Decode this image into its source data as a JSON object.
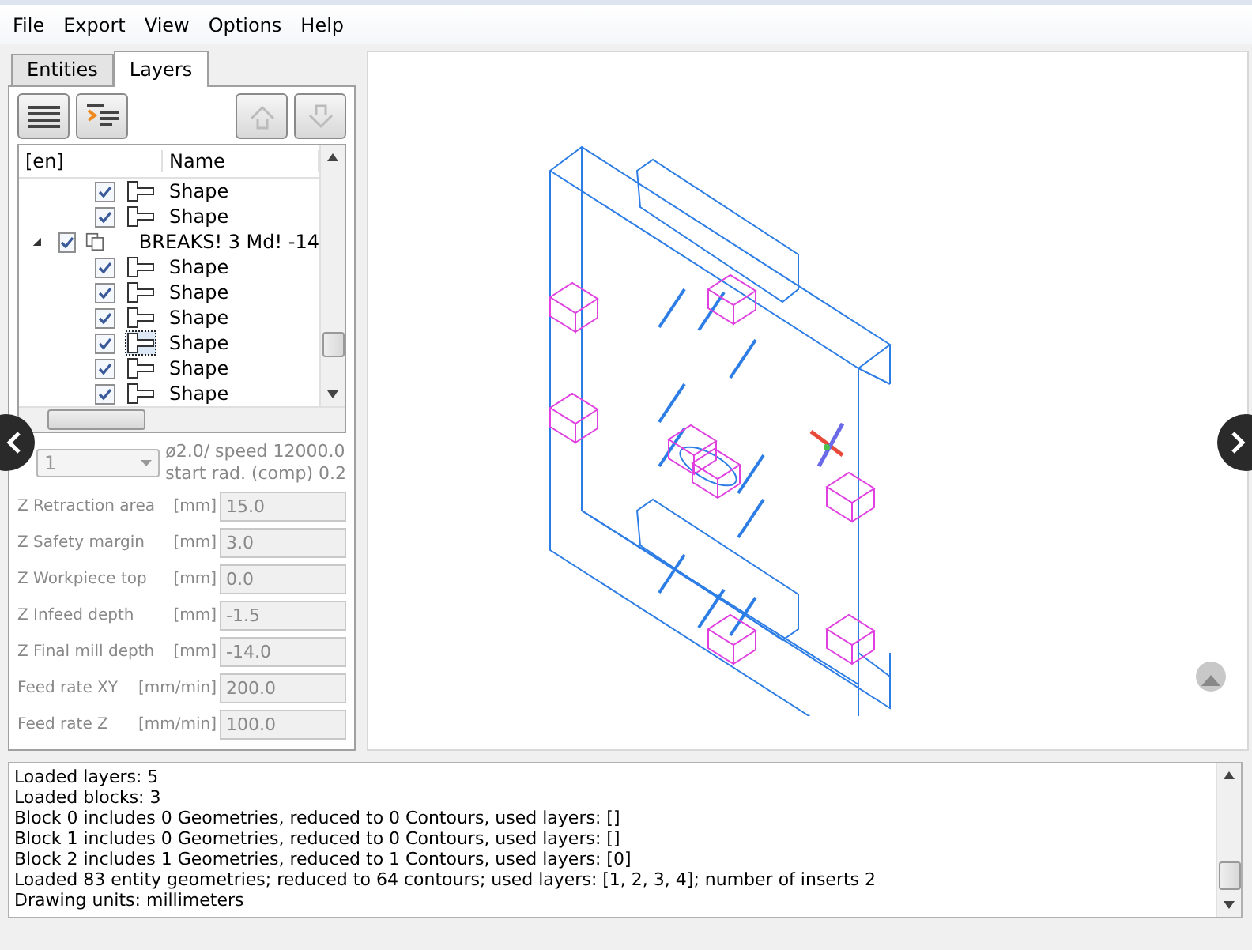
{
  "menu": [
    "File",
    "Export",
    "View",
    "Options",
    "Help"
  ],
  "tabs": [
    {
      "label": "Entities",
      "selected": false
    },
    {
      "label": "Layers",
      "selected": true
    }
  ],
  "tree": {
    "columns": [
      "[en]",
      "Name"
    ],
    "items": [
      {
        "kind": "hidden-parent",
        "children": [
          {
            "label": "Shape",
            "checked": true,
            "kind": "shape",
            "focused": false
          },
          {
            "label": "Shape",
            "checked": true,
            "kind": "shape",
            "focused": false
          }
        ]
      },
      {
        "kind": "layer",
        "label": "BREAKS! 3 Md! -14",
        "checked": true,
        "expanded": true,
        "children": [
          {
            "label": "Shape",
            "checked": true,
            "kind": "shape",
            "focused": false
          },
          {
            "label": "Shape",
            "checked": true,
            "kind": "shape",
            "focused": false
          },
          {
            "label": "Shape",
            "checked": true,
            "kind": "shape",
            "focused": false
          },
          {
            "label": "Shape",
            "checked": true,
            "kind": "shape",
            "focused": true
          },
          {
            "label": "Shape",
            "checked": true,
            "kind": "shape",
            "focused": false
          },
          {
            "label": "Shape",
            "checked": true,
            "kind": "shape",
            "focused": false
          }
        ]
      }
    ]
  },
  "tool": {
    "value": "1",
    "description": [
      "ø2.0/ speed 12000.0",
      "start rad. (comp) 0.2"
    ]
  },
  "fields": [
    {
      "label": "Z Retraction area",
      "unit": "[mm]",
      "value": "15.0"
    },
    {
      "label": "Z Safety margin",
      "unit": "[mm]",
      "value": "3.0"
    },
    {
      "label": "Z Workpiece top",
      "unit": "[mm]",
      "value": "0.0"
    },
    {
      "label": "Z Infeed depth",
      "unit": "[mm]",
      "value": "-1.5"
    },
    {
      "label": "Z Final mill depth",
      "unit": "[mm]",
      "value": "-14.0"
    },
    {
      "label": "Feed rate XY",
      "unit": "[mm/min]",
      "value": "200.0"
    },
    {
      "label": "Feed rate Z",
      "unit": "[mm/min]",
      "value": "100.0"
    }
  ],
  "log": [
    "Loaded layers: 5",
    "Loaded blocks: 3",
    "Block 0 includes 0 Geometries, reduced to 0 Contours, used layers: []",
    "Block 1 includes 0 Geometries, reduced to 0 Contours, used layers: []",
    "Block 2 includes 1 Geometries, reduced to 1 Contours, used layers: [0]",
    "Loaded 83 entity geometries; reduced to 64 contours; used layers: [1, 2, 3, 4]; number of inserts 2",
    "Drawing units: millimeters"
  ]
}
